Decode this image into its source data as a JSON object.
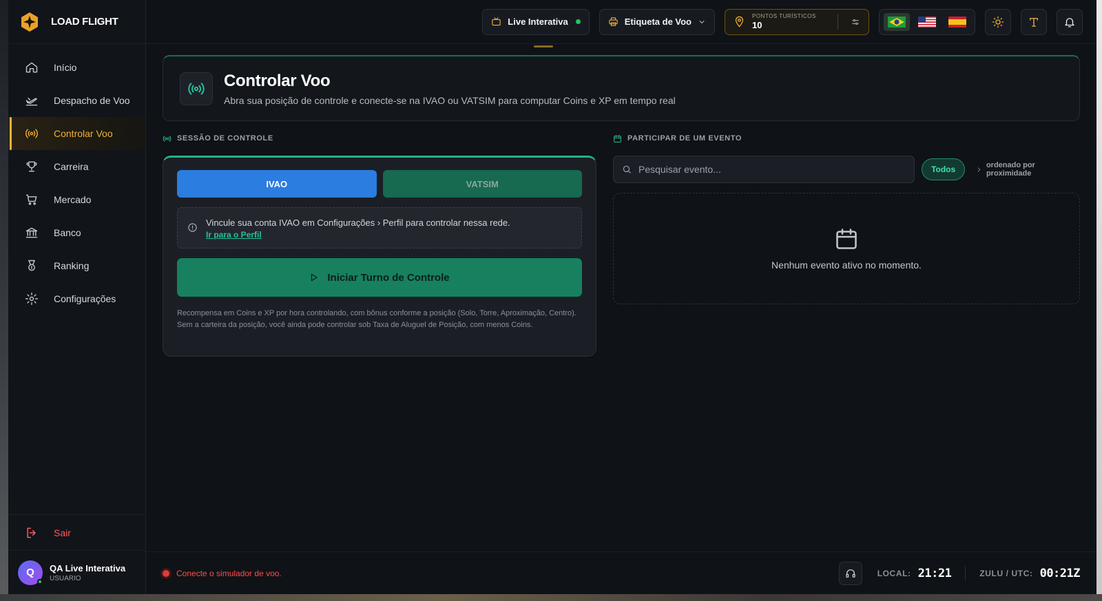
{
  "brand": {
    "name": "LOAD FLIGHT"
  },
  "sidebar": {
    "items": [
      {
        "label": "Início",
        "icon": "home-icon"
      },
      {
        "label": "Despacho de Voo",
        "icon": "plane-takeoff-icon"
      },
      {
        "label": "Controlar Voo",
        "icon": "radio-icon",
        "active": true
      },
      {
        "label": "Carreira",
        "icon": "trophy-icon"
      },
      {
        "label": "Mercado",
        "icon": "cart-icon"
      },
      {
        "label": "Banco",
        "icon": "bank-icon"
      },
      {
        "label": "Ranking",
        "icon": "medal-icon"
      },
      {
        "label": "Configurações",
        "icon": "gear-icon"
      }
    ],
    "logout": "Sair",
    "user": {
      "initial": "Q",
      "name": "QA Live Interativa",
      "role": "USUARIO"
    }
  },
  "topbar": {
    "live_label": "Live Interativa",
    "label_button": "Etiqueta de Voo",
    "points_label": "PONTOS TURÍSTICOS",
    "points_value": "10"
  },
  "header": {
    "title": "Controlar Voo",
    "subtitle": "Abra sua posição de controle e conecte-se na IVAO ou VATSIM para computar Coins e XP em tempo real"
  },
  "session": {
    "section_label": "SESSÃO DE CONTROLE",
    "tab_ivao": "IVAO",
    "tab_vatsim": "VATSIM",
    "notice_text": "Vincule sua conta IVAO em Configurações › Perfil para controlar nessa rede.",
    "notice_link": "Ir para o Perfil",
    "start_button": "Iniciar Turno de Controle",
    "footnote": "Recompensa em Coins e XP por hora controlando, com bônus conforme a posição (Solo, Torre, Aproximação, Centro). Sem a carteira da posição, você ainda pode controlar sob Taxa de Aluguel de Posição, com menos Coins."
  },
  "events": {
    "section_label": "PARTICIPAR DE UM EVENTO",
    "search_placeholder": "Pesquisar evento...",
    "filter_pill": "Todos",
    "sort_note": "ordenado por proximidade",
    "empty_text": "Nenhum evento ativo no momento."
  },
  "status": {
    "sim_text": "Conecte o simulador de voo.",
    "local_label": "LOCAL:",
    "local_time": "21:21",
    "zulu_label": "ZULU / UTC:",
    "zulu_time": "00:21Z"
  },
  "colors": {
    "accent": "#f0b23a",
    "teal": "#25c39a",
    "ivao": "#2b7de0",
    "vatsim": "#17694f",
    "danger": "#ff4d4d"
  }
}
